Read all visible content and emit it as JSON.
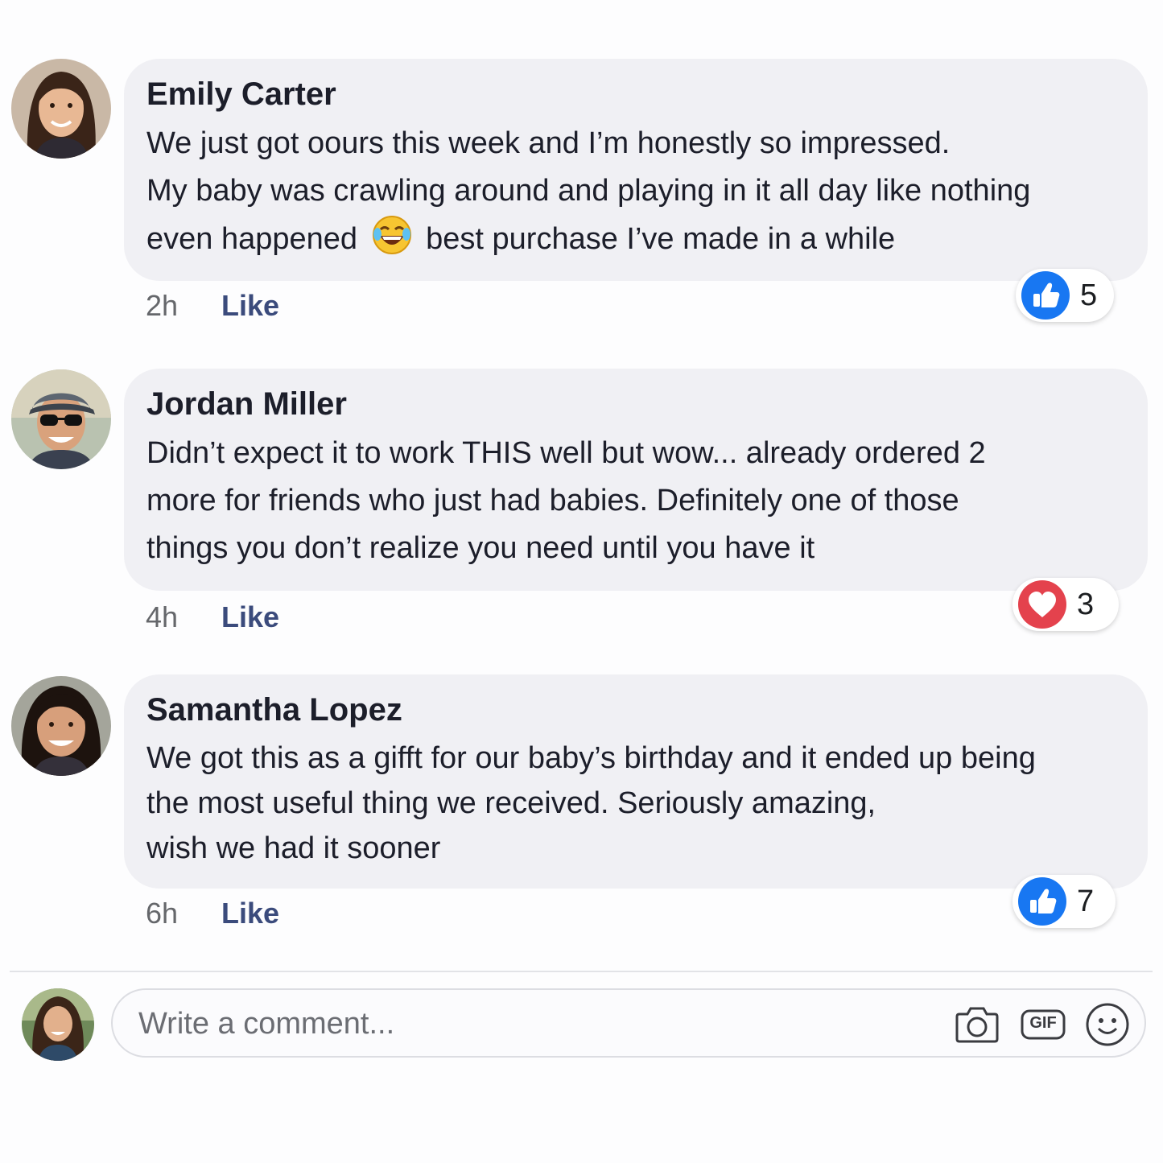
{
  "comments": [
    {
      "author": "Emily Carter",
      "lines": [
        "We just got oours this week and I’m honestly so impressed.",
        "My baby was crawling around and playing in it all day like nothing",
        "even happened",
        "best purchase I’ve made in a while"
      ],
      "time": "2h",
      "like_label": "Like",
      "reaction": {
        "type": "like",
        "count": "5"
      }
    },
    {
      "author": "Jordan Miller",
      "lines": [
        "Didn’t expect it to work THIS well but wow... already ordered 2",
        "more for friends who just had babies. Definitely one of those",
        "things you don’t realize you need until you have it"
      ],
      "time": "4h",
      "like_label": "Like",
      "reaction": {
        "type": "love",
        "count": "3"
      }
    },
    {
      "author": "Samantha Lopez",
      "lines": [
        "We got this as a gifft for our baby’s birthday and it ended up being",
        "the most useful thing we received. Seriously amazing,",
        "wish we had it sooner"
      ],
      "time": "6h",
      "like_label": "Like",
      "reaction": {
        "type": "like",
        "count": "7"
      }
    }
  ],
  "composer": {
    "placeholder": "Write a comment...",
    "gif_label": "GIF"
  },
  "colors": {
    "like_blue": "#1877f2",
    "love_red": "#e4424d",
    "bubble": "#f0f0f4",
    "link": "#3b4b7c"
  }
}
